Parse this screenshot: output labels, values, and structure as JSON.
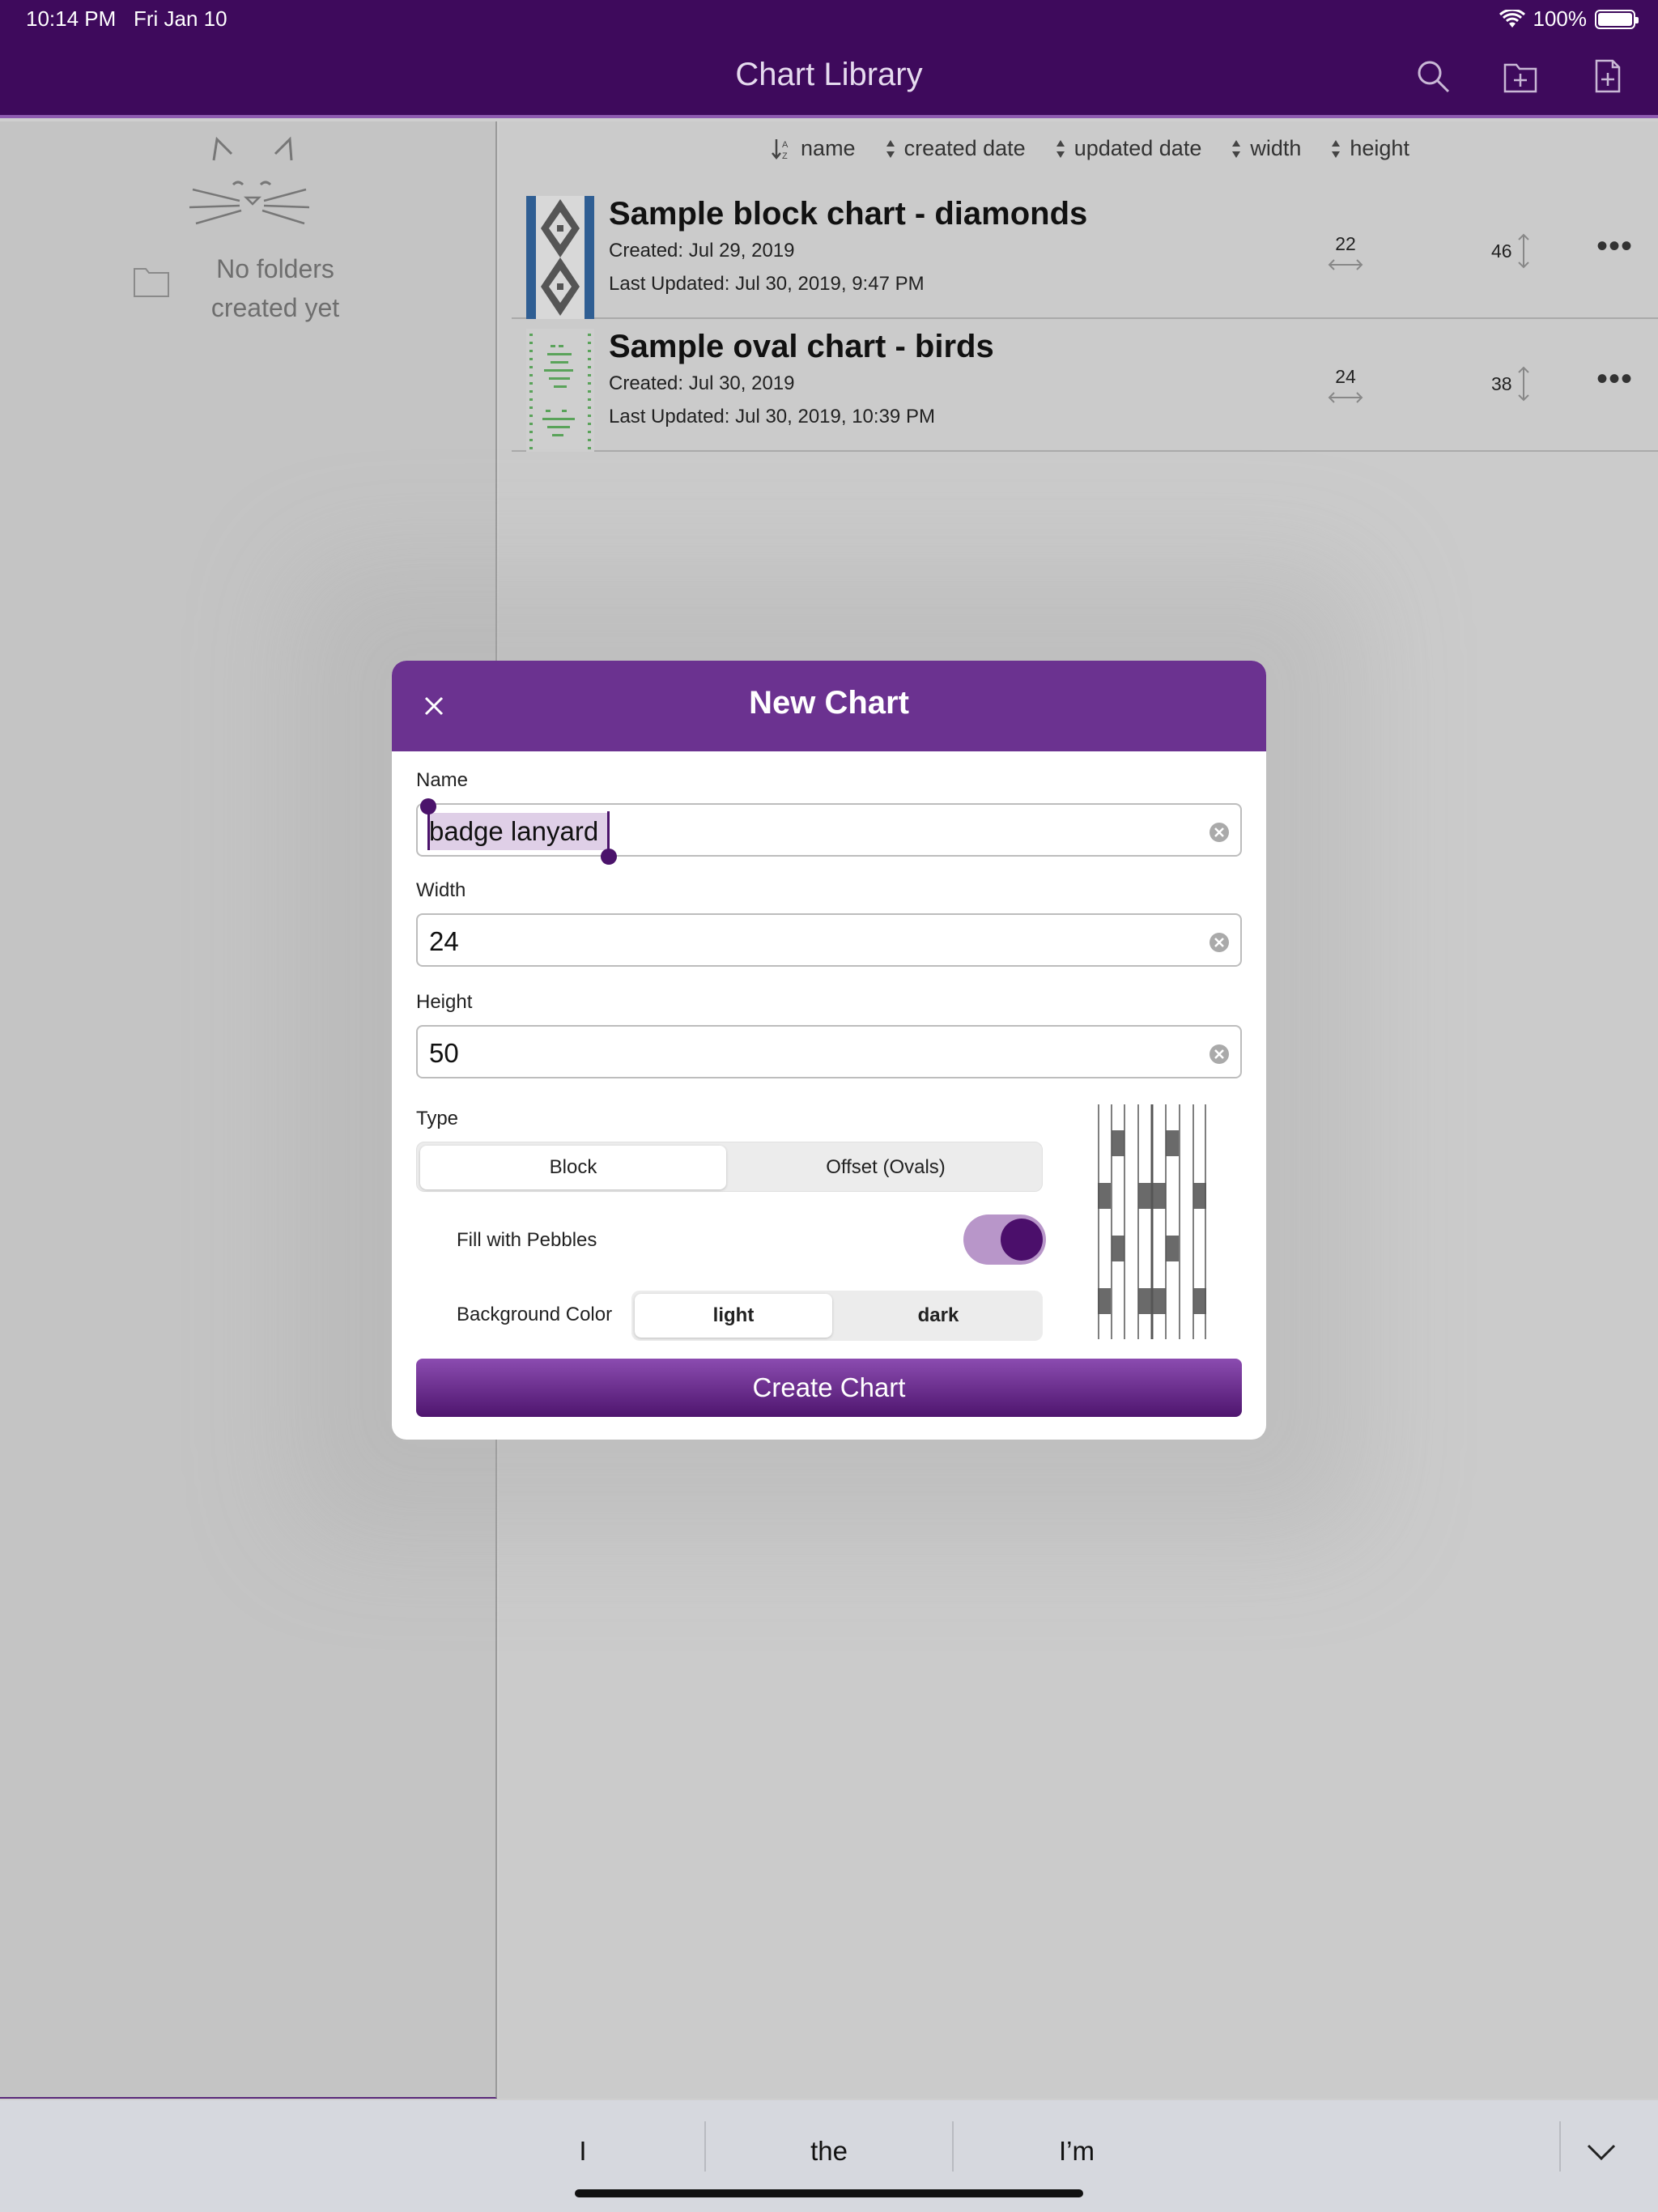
{
  "status": {
    "time": "10:14 PM",
    "date": "Fri Jan 10",
    "battery": "100%"
  },
  "header": {
    "title": "Chart Library"
  },
  "sidebar": {
    "empty_text_line1": "No folders",
    "empty_text_line2": "created yet"
  },
  "sort": {
    "name": "name",
    "created": "created date",
    "updated": "updated date",
    "width": "width",
    "height": "height"
  },
  "charts": [
    {
      "title": "Sample block chart - diamonds",
      "created": "Created: Jul 29, 2019",
      "updated": "Last Updated: Jul 30, 2019, 9:47 PM",
      "width": "22",
      "height": "46"
    },
    {
      "title": "Sample oval chart - birds",
      "created": "Created: Jul 30, 2019",
      "updated": "Last Updated: Jul 30, 2019, 10:39 PM",
      "width": "24",
      "height": "38"
    }
  ],
  "modal": {
    "title": "New Chart",
    "name_label": "Name",
    "name_value": "badge lanyard",
    "width_label": "Width",
    "width_value": "24",
    "height_label": "Height",
    "height_value": "50",
    "type_label": "Type",
    "type_block": "Block",
    "type_offset": "Offset (Ovals)",
    "fill_label": "Fill with Pebbles",
    "fill_enabled": true,
    "bg_label": "Background Color",
    "bg_light": "light",
    "bg_dark": "dark",
    "create_label": "Create Chart"
  },
  "keyboard": {
    "suggestions": [
      "I",
      "the",
      "I’m"
    ]
  },
  "colors": {
    "header": "#3e0a5c",
    "accent": "#6b3290",
    "toggle_on": "#4b0f6b"
  }
}
